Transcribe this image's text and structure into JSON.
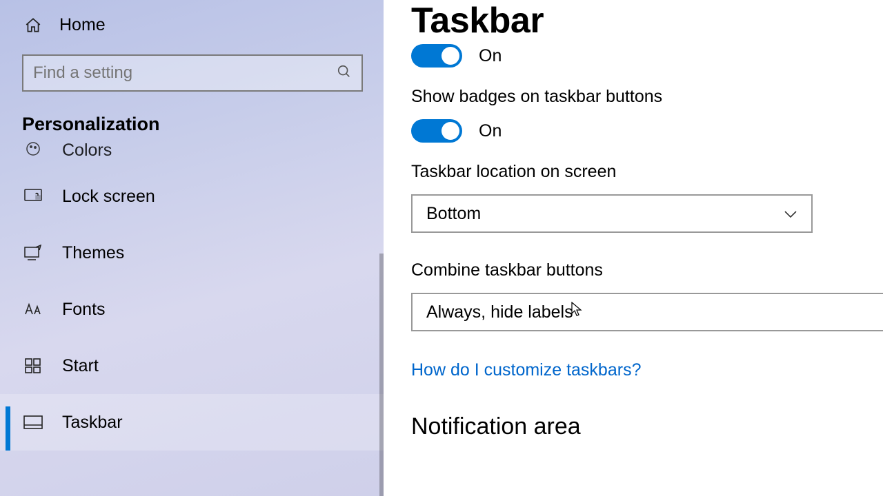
{
  "sidebar": {
    "home": "Home",
    "search_placeholder": "Find a setting",
    "section": "Personalization",
    "items": [
      {
        "label": "Colors"
      },
      {
        "label": "Lock screen"
      },
      {
        "label": "Themes"
      },
      {
        "label": "Fonts"
      },
      {
        "label": "Start"
      },
      {
        "label": "Taskbar"
      }
    ]
  },
  "page": {
    "title": "Taskbar",
    "toggle0_state": "On",
    "badges_label": "Show badges on taskbar buttons",
    "badges_state": "On",
    "location_label": "Taskbar location on screen",
    "location_value": "Bottom",
    "combine_label": "Combine taskbar buttons",
    "combine_value": "Always, hide labels",
    "help_link": "How do I customize taskbars?",
    "notif_heading": "Notification area"
  }
}
